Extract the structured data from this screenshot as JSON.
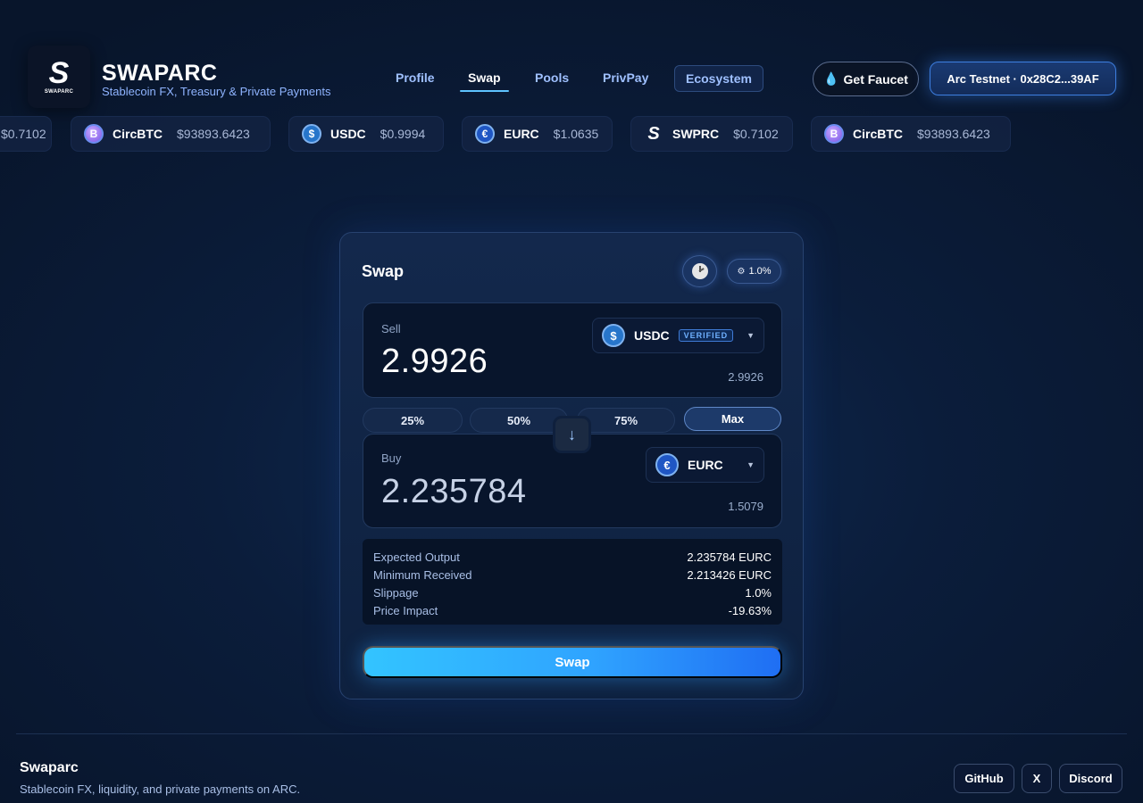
{
  "brand": {
    "logo_letter": "S",
    "logo_word": "SWAPARC",
    "title": "SWAPARC",
    "subtitle": "Stablecoin FX, Treasury & Private Payments"
  },
  "nav": {
    "profile": "Profile",
    "swap": "Swap",
    "pools": "Pools",
    "privpay": "PrivPay",
    "ecosystem": "Ecosystem",
    "active": "Swap"
  },
  "header": {
    "faucet_label": "Get Faucet",
    "faucet_icon": "water-drop-icon",
    "wallet_label": "Arc Testnet · 0x28C2...39AF"
  },
  "ticker": [
    {
      "symbol": "",
      "price": "$0.7102",
      "icon": "swprc-token-icon"
    },
    {
      "symbol": "CircBTC",
      "price": "$93893.6423",
      "icon": "circbtc-token-icon"
    },
    {
      "symbol": "USDC",
      "price": "$0.9994",
      "icon": "usdc-token-icon"
    },
    {
      "symbol": "EURC",
      "price": "$1.0635",
      "icon": "eurc-token-icon"
    },
    {
      "symbol": "SWPRC",
      "price": "$0.7102",
      "icon": "swprc-token-icon"
    },
    {
      "symbol": "CircBTC",
      "price": "$93893.6423",
      "icon": "circbtc-token-icon"
    }
  ],
  "swap": {
    "title": "Swap",
    "slippage_btn": "1.0%",
    "sell": {
      "label": "Sell",
      "amount": "2.9926",
      "balance": "2.9926",
      "token": "USDC",
      "badge": "VERIFIED"
    },
    "buy": {
      "label": "Buy",
      "amount": "2.235784",
      "balance": "1.5079",
      "token": "EURC"
    },
    "percent_buttons": [
      "25%",
      "50%",
      "75%",
      "Max"
    ],
    "details": [
      {
        "label": "Expected Output",
        "value": "2.235784 EURC"
      },
      {
        "label": "Minimum Received",
        "value": "2.213426 EURC"
      },
      {
        "label": "Slippage",
        "value": "1.0%"
      },
      {
        "label": "Price Impact",
        "value": "-19.63%"
      }
    ],
    "cta": "Swap"
  },
  "footer": {
    "brand": "Swaparc",
    "tagline": "Stablecoin FX, liquidity, and private payments on ARC.",
    "links": [
      "GitHub",
      "X",
      "Discord"
    ]
  },
  "colors": {
    "accent": "#33c4ff",
    "accent_end": "#1f6ef3",
    "background": "#0b1d3b",
    "nav_link": "#9fc0ff"
  }
}
